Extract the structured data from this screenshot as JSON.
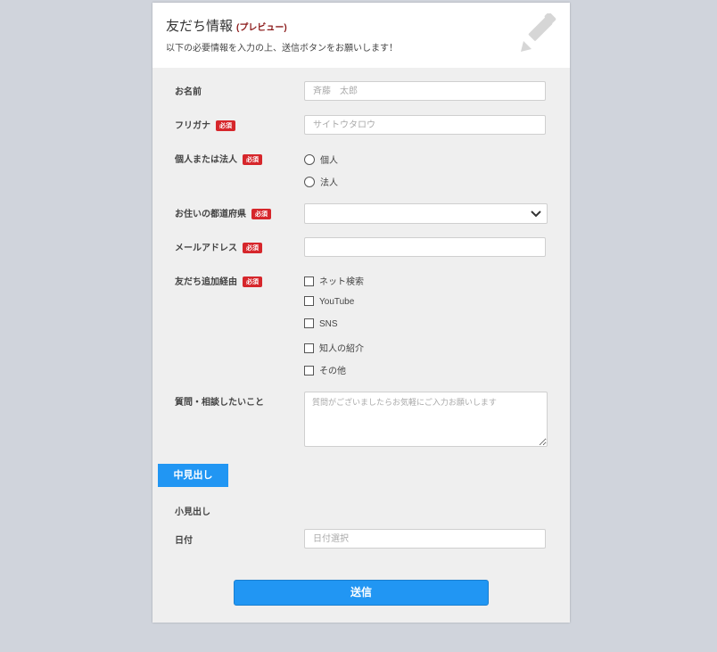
{
  "header": {
    "title": "友だち情報",
    "title_badge": "(プレビュー)",
    "subtitle": "以下の必要情報を入力の上、送信ボタンをお願いします！"
  },
  "required_label": "必須",
  "fields": {
    "name": {
      "label": "お名前",
      "placeholder": "斉藤　太郎"
    },
    "furigana": {
      "label": "フリガナ",
      "placeholder": "サイトウタロウ"
    },
    "entity": {
      "label": "個人または法人",
      "options": [
        "個人",
        "法人"
      ]
    },
    "prefecture": {
      "label": "お住いの都道府県",
      "value": ""
    },
    "email": {
      "label": "メールアドレス",
      "placeholder": ""
    },
    "referral": {
      "label": "友だち追加経由",
      "options": [
        "ネット検索",
        "YouTube",
        "SNS",
        "知人の紹介",
        "その他"
      ]
    },
    "question": {
      "label": "質問・相談したいこと",
      "placeholder": "質問がございましたらお気軽にご入力お願いします"
    },
    "section_heading": "中見出し",
    "sub_heading": "小見出し",
    "date": {
      "label": "日付",
      "placeholder": "日付選択"
    }
  },
  "submit_label": "送信",
  "colors": {
    "accent": "#2196f3",
    "required": "#d6262b",
    "page_bg": "#d0d4dc"
  }
}
